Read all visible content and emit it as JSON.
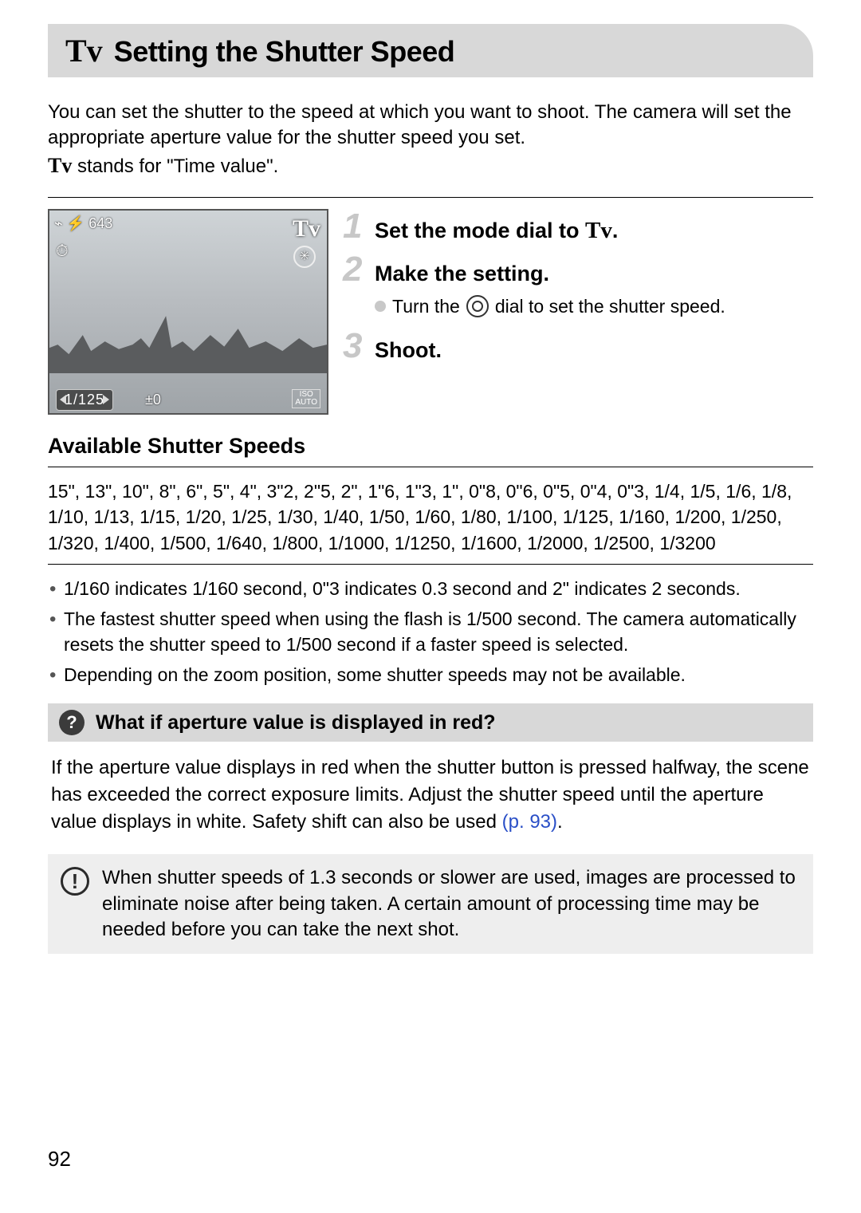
{
  "title": {
    "mode": "Tv",
    "text": "Setting the Shutter Speed"
  },
  "intro": {
    "p1": "You can set the shutter to the speed at which you want to shoot. The camera will set the appropriate aperture value for the shutter speed you set.",
    "tv": "Tv",
    "tv_def": " stands for \"Time value\"."
  },
  "lcd": {
    "top": "⌁ ⚡ 643",
    "left": "⏱",
    "tv": "Tv",
    "aux": "✳",
    "shutter": "1/125",
    "ev": "±0",
    "iso_top": "ISO",
    "iso_bot": "AUTO"
  },
  "steps": {
    "s1_num": "1",
    "s1_pre": "Set the mode dial to ",
    "s1_tv": "Tv",
    "s1_suf": ".",
    "s2_num": "2",
    "s2": "Make the setting.",
    "s2_sub_pre": "Turn the ",
    "s2_sub_suf": " dial to set the shutter speed.",
    "s3_num": "3",
    "s3": "Shoot."
  },
  "avail_h": "Available Shutter Speeds",
  "speeds": "15\", 13\", 10\", 8\", 6\", 5\", 4\", 3\"2, 2\"5, 2\", 1\"6, 1\"3, 1\", 0\"8, 0\"6, 0\"5, 0\"4, 0\"3, 1/4, 1/5, 1/6, 1/8, 1/10, 1/13, 1/15, 1/20, 1/25, 1/30, 1/40, 1/50, 1/60, 1/80, 1/100, 1/125, 1/160, 1/200, 1/250, 1/320, 1/400, 1/500, 1/640, 1/800, 1/1000, 1/1250, 1/1600, 1/2000, 1/2500, 1/3200",
  "notes": {
    "n1": "1/160 indicates 1/160 second, 0\"3 indicates 0.3 second and 2\" indicates 2 seconds.",
    "n2": "The fastest shutter speed when using the flash is 1/500 second. The camera automatically resets the shutter speed to 1/500 second if a faster speed is selected.",
    "n3": "Depending on the zoom position, some shutter speeds may not be available."
  },
  "q": {
    "icon": "?",
    "title": "What if aperture value is displayed in red?",
    "body_pre": "If the aperture value displays in red when the shutter button is pressed halfway, the scene has exceeded the correct exposure limits. Adjust the shutter speed until the aperture value displays in white. Safety shift can also be used ",
    "link": "(p. 93)",
    "body_suf": "."
  },
  "warn": {
    "icon": "!",
    "text": "When shutter speeds of 1.3 seconds or slower are used, images are processed to eliminate noise after being taken. A certain amount of processing time may be needed before you can take the next shot."
  },
  "page": "92"
}
